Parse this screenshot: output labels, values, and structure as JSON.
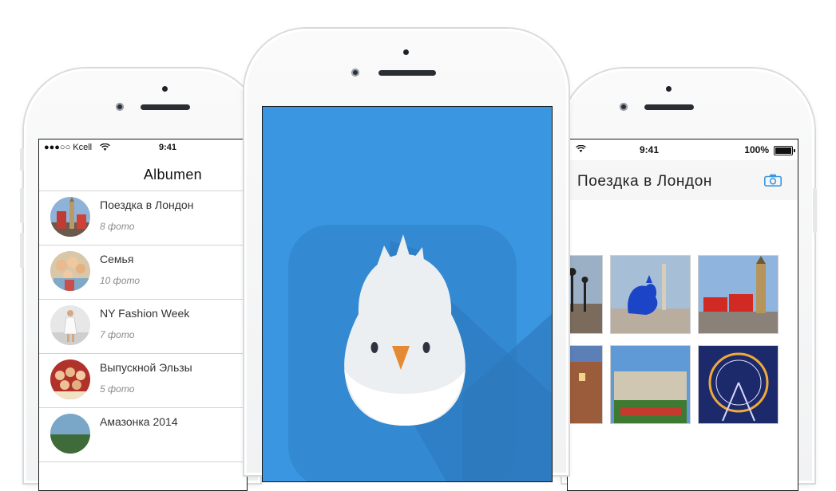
{
  "left_phone": {
    "status": {
      "carrier": "●●●○○ Kcell",
      "time": "9:41"
    },
    "title": "Albumen",
    "albums": [
      {
        "name": "Поездка в Лондон",
        "count": "8 фото"
      },
      {
        "name": "Семья",
        "count": "10 фото"
      },
      {
        "name": "NY Fashion Week",
        "count": "7 фото"
      },
      {
        "name": "Выпускной Эльзы",
        "count": "5 фото"
      },
      {
        "name": "Амазонка 2014",
        "count": ""
      }
    ]
  },
  "right_phone": {
    "status": {
      "time": "9:41",
      "battery": "100%"
    },
    "title": "Поездка в Лондон",
    "camera_icon": "camera-icon",
    "photos": [
      {
        "subject": "street-lamps"
      },
      {
        "subject": "blue-rooster-trafalgar"
      },
      {
        "subject": "big-ben-red-buses"
      },
      {
        "subject": "harrods-building"
      },
      {
        "subject": "buckingham-palace"
      },
      {
        "subject": "london-eye-night"
      }
    ]
  },
  "colors": {
    "accent_blue": "#3a96e0",
    "splash_bg": "#3a96e0",
    "beak": "#e58a34"
  }
}
